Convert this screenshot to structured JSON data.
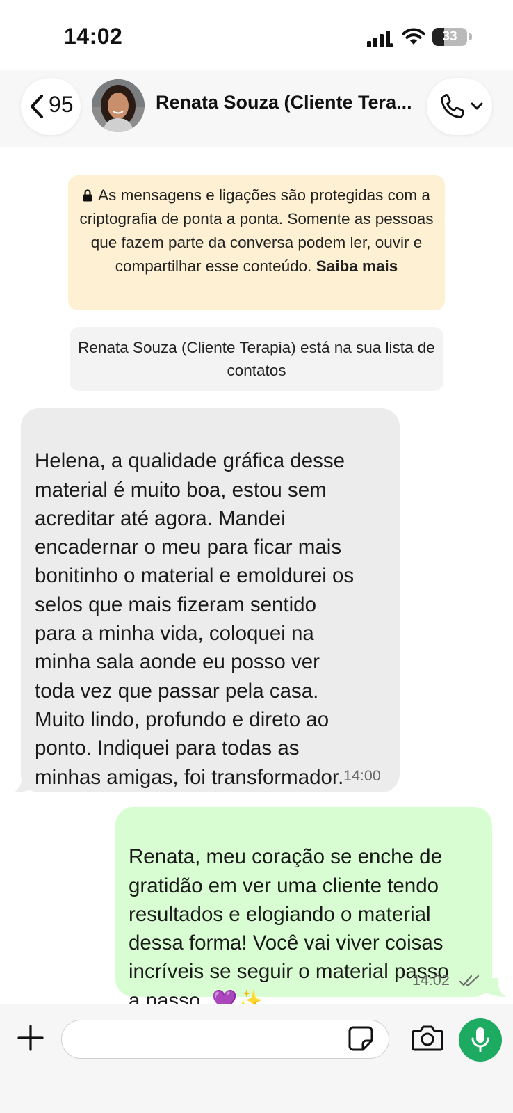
{
  "status_bar": {
    "time": "14:02",
    "battery_level": "33",
    "signal_icon": "signal-bars-icon",
    "wifi_icon": "wifi-icon"
  },
  "header": {
    "back_icon": "chevron-left-icon",
    "unread_count": "95",
    "contact_name": "Renata Souza (Cliente Tera...",
    "call_icon": "phone-icon",
    "call_menu_icon": "chevron-down-icon"
  },
  "notices": {
    "encryption_text": "As mensagens e ligações são protegidas com a criptografia de ponta a ponta. Somente as pessoas que fazem parte da conversa podem ler, ouvir e compartilhar esse conteúdo.",
    "encryption_link": "Saiba mais",
    "contact_text": "Renata Souza (Cliente Terapia) está na sua lista de contatos"
  },
  "messages": [
    {
      "direction": "incoming",
      "text": "Helena, a qualidade gráfica desse\nmaterial é muito boa, estou sem\nacreditar até agora. Mandei\nencadernar o meu para ficar  mais\nbonitinho o material e emoldurei os\nselos que mais fizeram sentido\npara a minha vida, coloquei na\nminha sala aonde eu posso ver\ntoda vez que passar pela casa.\nMuito lindo, profundo e direto ao\nponto. Indiquei para todas as\nminhas amigas, foi transformador.",
      "time": "14:00"
    },
    {
      "direction": "outgoing",
      "text": "Renata, meu coração se enche de\ngratidão em ver uma cliente tendo\nresultados e elogiando o material\ndessa forma! Você vai viver coisas\nincríveis se seguir o material passo\na passo. 💜✨",
      "time": "14:02",
      "status_icon": "double-check-icon"
    }
  ],
  "input_bar": {
    "placeholder": "",
    "plus_icon": "plus-icon",
    "sticker_icon": "sticker-icon",
    "camera_icon": "camera-icon",
    "mic_icon": "microphone-icon"
  },
  "colors": {
    "outgoing_bubble": "#d9fdd3",
    "incoming_bubble": "#ececec",
    "encryption_notice": "#fdf0d3",
    "mic_button": "#1daa61"
  }
}
